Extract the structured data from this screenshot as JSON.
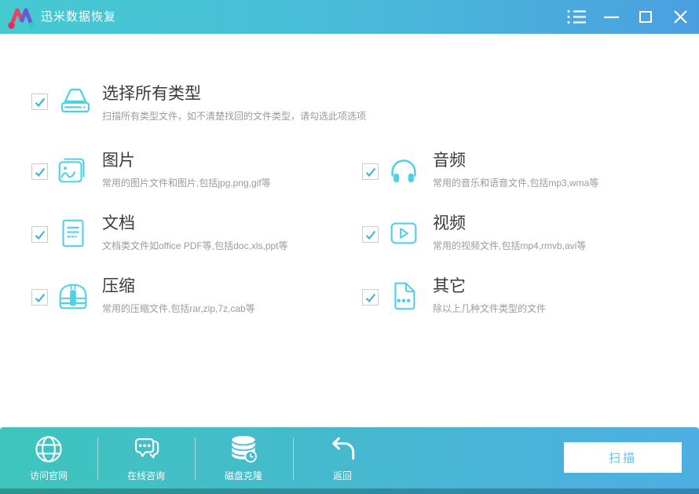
{
  "titlebar": {
    "app_title": "迅米数据恢复"
  },
  "select_all": {
    "label": "选择所有类型",
    "description": "扫描所有类型文件，如不清楚找回的文件类型，请勾选此项选项",
    "checked": true
  },
  "file_types": [
    {
      "label": "图片",
      "description": "常用的图片文件和图片,包括jpg,png,gif等",
      "icon": "photos-icon",
      "checked": true
    },
    {
      "label": "音频",
      "description": "常用的音乐和语音文件,包括mp3,wma等",
      "icon": "headphones-icon",
      "checked": true
    },
    {
      "label": "文档",
      "description": "文档类文件如office PDF等,包括doc,xls,ppt等",
      "icon": "document-icon",
      "checked": true
    },
    {
      "label": "视频",
      "description": "常用的视频文件,包括mp4,rmvb,avi等",
      "icon": "play-icon",
      "checked": true
    },
    {
      "label": "压缩",
      "description": "常用的压缩文件,包括rar,zip,7z,cab等",
      "icon": "zip-archive-icon",
      "checked": true
    },
    {
      "label": "其它",
      "description": "除以上几种文件类型的文件",
      "icon": "file-other-icon",
      "checked": true
    }
  ],
  "toolbar": {
    "items": [
      {
        "label": "访问官网",
        "icon": "globe-icon"
      },
      {
        "label": "在线咨询",
        "icon": "chat-bubbles-icon"
      },
      {
        "label": "磁盘克隆",
        "icon": "disk-stack-clock-icon"
      },
      {
        "label": "返回",
        "icon": "back-arrow-icon"
      }
    ],
    "scan_label": "扫描"
  },
  "colors": {
    "accent_cyan": "#50d0e6",
    "check_mark": "#3fb3dc",
    "titlebar_gradient": [
      "#45cad1",
      "#4a9fe1"
    ],
    "footer_gradient": [
      "#3fc5bd",
      "#4daee2"
    ],
    "scan_text": "#5fc0e8",
    "title_text": "#3a3a3a",
    "description_text": "#9b9b9b"
  }
}
